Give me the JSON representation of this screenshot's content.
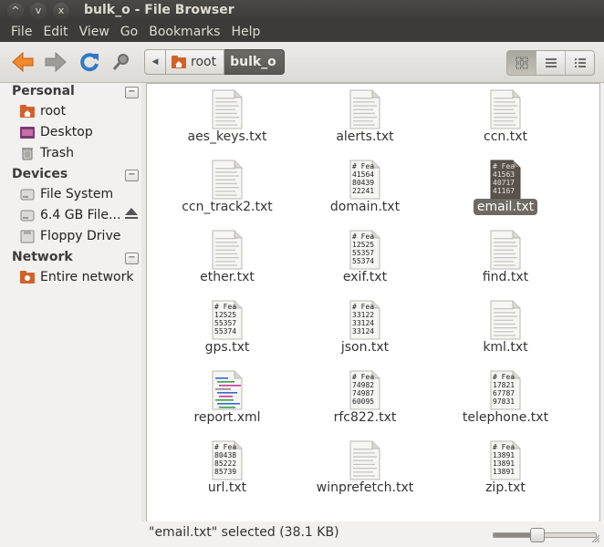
{
  "window": {
    "title": "bulk_o - File Browser",
    "controls": [
      "^",
      "v",
      "x"
    ]
  },
  "menubar": [
    "File",
    "Edit",
    "View",
    "Go",
    "Bookmarks",
    "Help"
  ],
  "toolbar": {
    "icons": [
      "back-arrow-icon",
      "forward-arrow-icon",
      "reload-icon",
      "search-icon"
    ],
    "breadcrumbs": [
      "root",
      "bulk_o"
    ],
    "view_modes": [
      "icon-view-icon",
      "list-view-icon",
      "compact-view-icon"
    ],
    "active_view": 0
  },
  "sidebar": {
    "sections": [
      {
        "title": "Personal",
        "items": [
          {
            "label": "root",
            "icon": "home-folder-icon"
          },
          {
            "label": "Desktop",
            "icon": "desktop-icon"
          },
          {
            "label": "Trash",
            "icon": "trash-icon"
          }
        ]
      },
      {
        "title": "Devices",
        "items": [
          {
            "label": "File System",
            "icon": "drive-icon"
          },
          {
            "label": "6.4 GB File...",
            "icon": "drive-icon"
          },
          {
            "label": "Floppy Drive",
            "icon": "floppy-icon"
          }
        ]
      },
      {
        "title": "Network",
        "items": [
          {
            "label": "Entire network",
            "icon": "network-folder-icon"
          }
        ]
      }
    ],
    "collapse_symbol": "−"
  },
  "files": [
    {
      "name": "aes_keys.txt",
      "preview": []
    },
    {
      "name": "alerts.txt",
      "preview": []
    },
    {
      "name": "ccn.txt",
      "preview": []
    },
    {
      "name": "ccn_track2.txt",
      "preview": []
    },
    {
      "name": "domain.txt",
      "preview": [
        "# Fea",
        "41564",
        "80439",
        "22241"
      ]
    },
    {
      "name": "email.txt",
      "preview": [
        "# Fea",
        "41563",
        "40717",
        "41167"
      ],
      "selected": true
    },
    {
      "name": "ether.txt",
      "preview": []
    },
    {
      "name": "exif.txt",
      "preview": [
        "# Fea",
        "12525",
        "55357",
        "55374"
      ]
    },
    {
      "name": "find.txt",
      "preview": []
    },
    {
      "name": "gps.txt",
      "preview": [
        "# Fea",
        "12525",
        "55357",
        "55374"
      ]
    },
    {
      "name": "json.txt",
      "preview": [
        "# Fea",
        "33122",
        "33124",
        "33124"
      ]
    },
    {
      "name": "kml.txt",
      "preview": []
    },
    {
      "name": "report.xml",
      "preview": [],
      "xml": true
    },
    {
      "name": "rfc822.txt",
      "preview": [
        "# Fea",
        "74982",
        "74987",
        "60095"
      ]
    },
    {
      "name": "telephone.txt",
      "preview": [
        "# Fea",
        "17821",
        "67787",
        "97831"
      ]
    },
    {
      "name": "url.txt",
      "preview": [
        "# Fea",
        "80438",
        "85222",
        "85739"
      ]
    },
    {
      "name": "winprefetch.txt",
      "preview": []
    },
    {
      "name": "zip.txt",
      "preview": [
        "# Fea",
        "13891",
        "13891",
        "13891"
      ]
    }
  ],
  "statusbar": {
    "text": "\"email.txt\" selected (38.1 KB)",
    "zoom_fraction": 0.42
  },
  "colors": {
    "selection": "#6e6a63",
    "titlebar": "#3c3b37",
    "accent_orange": "#e9782b"
  }
}
